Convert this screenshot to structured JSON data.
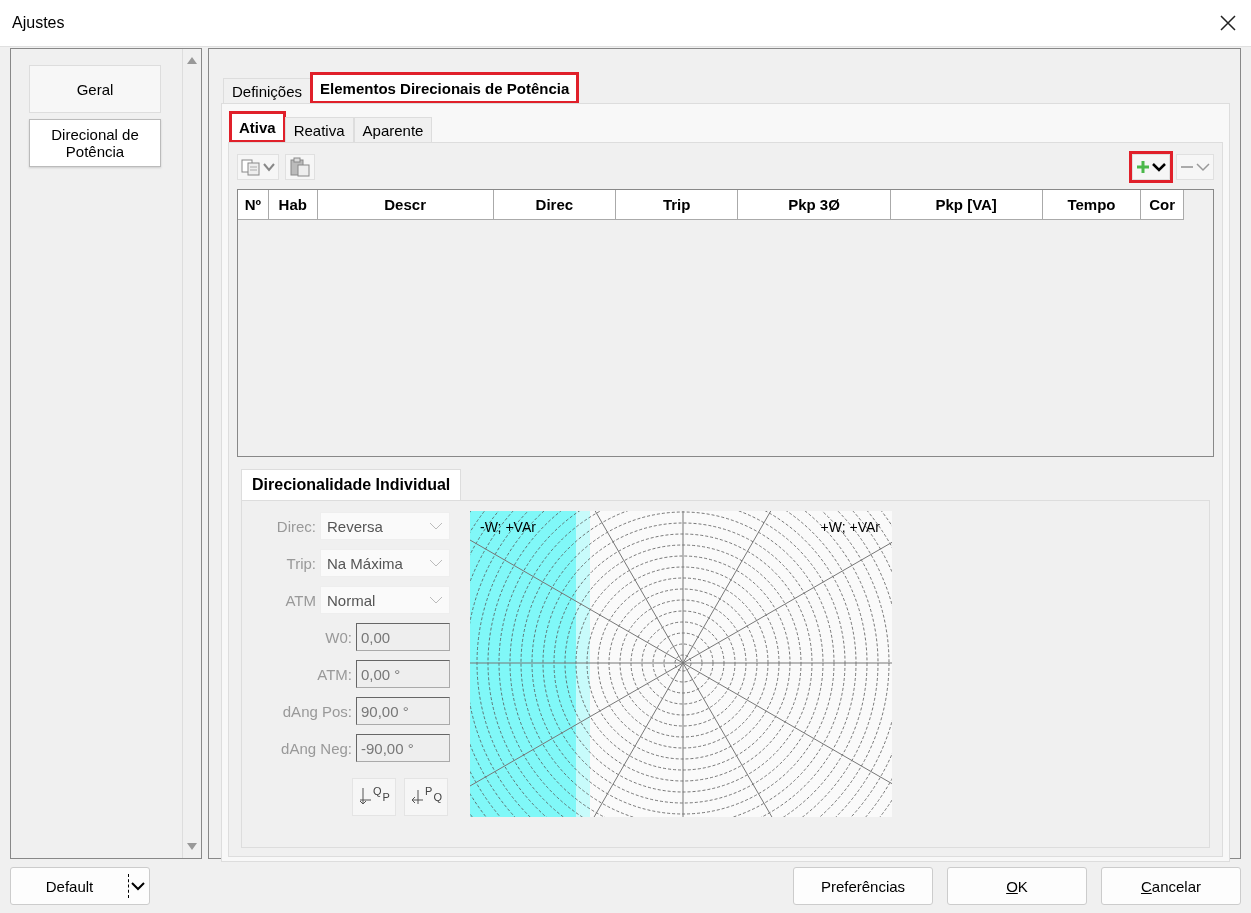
{
  "window": {
    "title": "Ajustes"
  },
  "sidebar": {
    "items": [
      {
        "label": "Geral",
        "selected": false
      },
      {
        "label": "Direcional de Potência",
        "selected": true
      }
    ]
  },
  "tabs": [
    {
      "label": "Definições",
      "selected": false,
      "highlighted": false
    },
    {
      "label": "Elementos Direcionais de Potência",
      "selected": true,
      "highlighted": true
    }
  ],
  "subtabs": [
    {
      "label": "Ativa",
      "selected": true,
      "highlighted": true
    },
    {
      "label": "Reativa",
      "selected": false,
      "highlighted": false
    },
    {
      "label": "Aparente",
      "selected": false,
      "highlighted": false
    }
  ],
  "toolbar": {
    "add_highlighted": true
  },
  "table": {
    "columns": [
      "Nº",
      "Hab",
      "Descr",
      "Direc",
      "Trip",
      "Pkp 3Ø",
      "Pkp [VA]",
      "Tempo",
      "Cor"
    ]
  },
  "section": {
    "title": "Direcionalidade Individual",
    "fields": [
      {
        "kind": "select",
        "label": "Direc:",
        "value": "Reversa",
        "disabled": true
      },
      {
        "kind": "select",
        "label": "Trip:",
        "value": "Na Máxima",
        "disabled": true
      },
      {
        "kind": "select",
        "label": "ATM",
        "value": "Normal",
        "disabled": true
      },
      {
        "kind": "input",
        "label": "W0:",
        "value": "0,00",
        "disabled": true
      },
      {
        "kind": "input",
        "label": "ATM:",
        "value": "0,00 °",
        "disabled": true
      },
      {
        "kind": "input",
        "label": "dAng Pos:",
        "value": "90,00 °",
        "disabled": true
      },
      {
        "kind": "input",
        "label": "dAng Neg:",
        "value": "-90,00 °",
        "disabled": true
      }
    ],
    "axis_buttons": [
      {
        "top": "Q",
        "side": "P"
      },
      {
        "top": "P",
        "side": "Q"
      }
    ],
    "plot_labels": [
      "-W; +VAr",
      "+W; +VAr"
    ]
  },
  "footer": {
    "profile": "Default",
    "buttons": [
      "Preferências",
      "OK",
      "Cancelar"
    ]
  }
}
